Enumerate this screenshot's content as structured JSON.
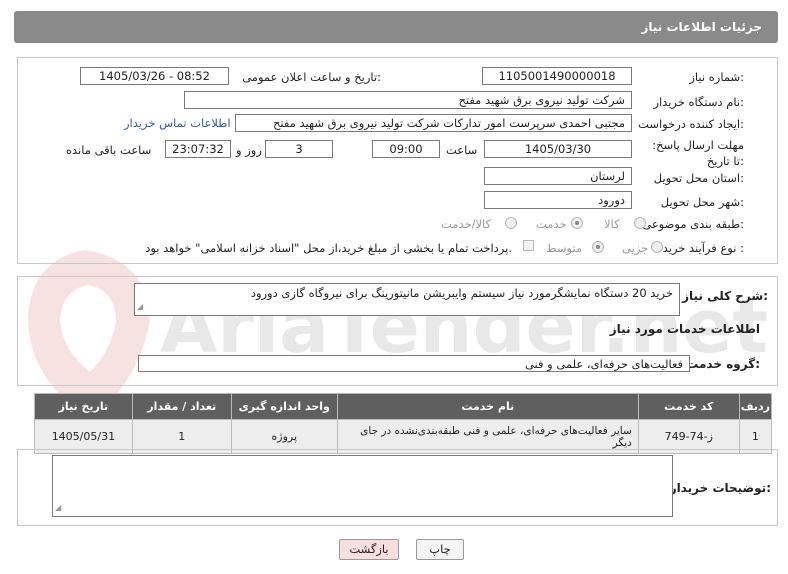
{
  "header": {
    "title": "جزئیات اطلاعات نیاز"
  },
  "watermark": {
    "text": "AriaTender.net"
  },
  "form": {
    "need_number": {
      "label": "شماره نیاز:",
      "value": "1105001490000018"
    },
    "announce_datetime": {
      "label": "تاریخ و ساعت اعلان عمومی:",
      "value": "1405/03/26 - 08:52"
    },
    "buyer_org": {
      "label": "نام دستگاه خریدار:",
      "value": "شرکت تولید نیروی برق شهید مفتح"
    },
    "requester": {
      "label": "ایجاد کننده درخواست:",
      "value": "مجتبی احمدی سرپرست امور تدارکات شرکت تولید نیروی برق شهید مفتح",
      "contact_link": "اطلاعات تماس خریدار"
    },
    "deadline": {
      "label": "مهلت ارسال پاسخ: تا تاریخ:",
      "date": "1405/03/30",
      "time_label": "ساعت",
      "time": "09:00",
      "days": "3",
      "days_label": "روز و",
      "remaining": "23:07:32",
      "remaining_label": "ساعت باقی مانده"
    },
    "province": {
      "label": "استان محل تحویل:",
      "value": "لرستان"
    },
    "city": {
      "label": "شهر محل تحویل:",
      "value": "دورود"
    },
    "category": {
      "label": "طبقه بندی موضوعی:",
      "options": [
        "کالا",
        "خدمت",
        "کالا/خدمت"
      ],
      "selected": "خدمت"
    },
    "purchase_type": {
      "label": "نوع فرآیند خرید :",
      "options": [
        "جزیی",
        "متوسط"
      ],
      "selected": "متوسط",
      "note": "پرداخت تمام یا بخشی از مبلغ خرید،از محل \"اسناد خزانه اسلامی\" خواهد بود."
    }
  },
  "summary": {
    "label": "شرح کلی نیاز:",
    "value": "خرید 20 دستگاه  نمایشگرمورد نیاز سیستم  وایبریشن  مانیتورینگ برای  نیروگاه گازی دورود"
  },
  "services": {
    "section_title": "اطلاعات خدمات مورد نیاز",
    "group_label": "گروه خدمت:",
    "group_value": "فعالیت‌های حرفه‌ای، علمی و فنی",
    "columns": [
      "ردیف",
      "کد خدمت",
      "نام خدمت",
      "واحد اندازه گیری",
      "تعداد / مقدار",
      "تاریخ نیاز"
    ],
    "rows": [
      {
        "row": "1",
        "code": "ز-74-749",
        "name": "سایر فعالیت‌های حرفه‌ای، علمی و فنی طبقه‌بندی‌نشده در جای دیگر",
        "unit": "پروژه",
        "qty": "1",
        "date": "1405/05/31"
      }
    ]
  },
  "buyer_notes": {
    "label": "توضیحات خریدار:",
    "value": ""
  },
  "buttons": {
    "print": "چاپ",
    "back": "بازگشت"
  },
  "colors": {
    "header_bg": "#8a8a8a",
    "table_header_bg": "#5f5f5f",
    "link": "#2a5db0",
    "back_button_bg": "#f8dede"
  }
}
